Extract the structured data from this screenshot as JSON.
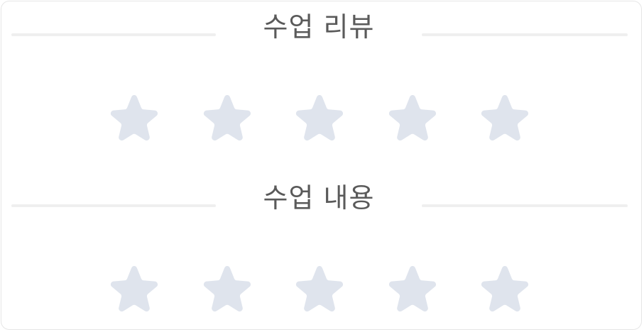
{
  "colors": {
    "star_empty": "#dfe4ed",
    "title_text": "#5a5a5a",
    "divider": "#efefef",
    "card_border": "#e6e6e6"
  },
  "sections": [
    {
      "title": "수업 리뷰",
      "rating": 0,
      "max_rating": 5,
      "star_icon": "star-icon"
    },
    {
      "title": "수업 내용",
      "rating": 0,
      "max_rating": 5,
      "star_icon": "star-icon"
    }
  ]
}
